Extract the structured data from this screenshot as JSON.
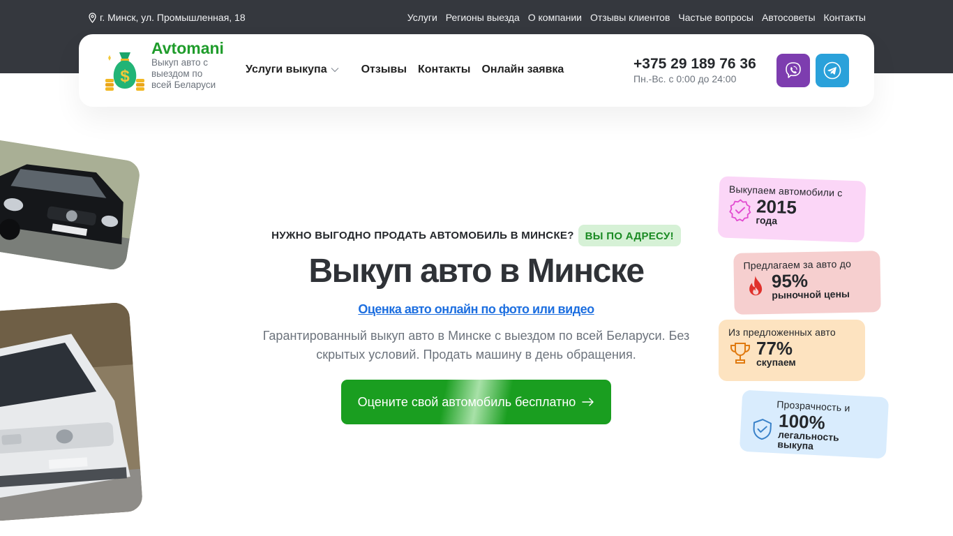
{
  "topbar": {
    "address": "г. Минск, ул. Промышленная, 18",
    "links": [
      "Услуги",
      "Регионы выезда",
      "О компании",
      "Отзывы клиентов",
      "Частые вопросы",
      "Автосоветы",
      "Контакты"
    ]
  },
  "header": {
    "brand_name": "Avtomani",
    "brand_subtitle": "Выкуп авто с выездом по всей Беларуси",
    "nav": [
      "Услуги выкупа",
      "Отзывы",
      "Контакты",
      "Онлайн заявка"
    ],
    "phone": "+375 29 189 76 36",
    "hours": "Пн.-Вс. с 0:00 до 24:00",
    "messengers": [
      "viber-icon",
      "telegram-icon"
    ]
  },
  "hero": {
    "tagline": "НУЖНО ВЫГОДНО ПРОДАТЬ АВТОМОБИЛЬ В МИНСКЕ?",
    "tag_badge": "ВЫ ПО АДРЕСУ!",
    "title": "Выкуп авто в Минске",
    "eval_link": "Оценка авто онлайн по фото или видео",
    "description": "Гарантированный выкуп авто в Минске с выездом по всей Беларуси. Без скрытых условий. Продать машину в день обращения.",
    "cta": "Оцените свой автомобиль бесплатно"
  },
  "stats": [
    {
      "title": "Выкупаем автомобили с",
      "value": "2015",
      "unit": "года",
      "icon": "check-badge-icon"
    },
    {
      "title": "Предлагаем за авто до",
      "value": "95%",
      "unit": "рыночной цены",
      "icon": "flame-icon"
    },
    {
      "title": "Из предложенных авто",
      "value": "77%",
      "unit": "скупаем",
      "icon": "trophy-icon"
    },
    {
      "title": "Прозрачность и",
      "value": "100%",
      "unit": "легальность выкупа",
      "icon": "shield-check-icon"
    }
  ],
  "colors": {
    "brand_green": "#1f9c2b",
    "dark_band": "#35383e",
    "link_blue": "#1d6fe0",
    "viber": "#7d3daf",
    "telegram": "#2aa1da"
  }
}
